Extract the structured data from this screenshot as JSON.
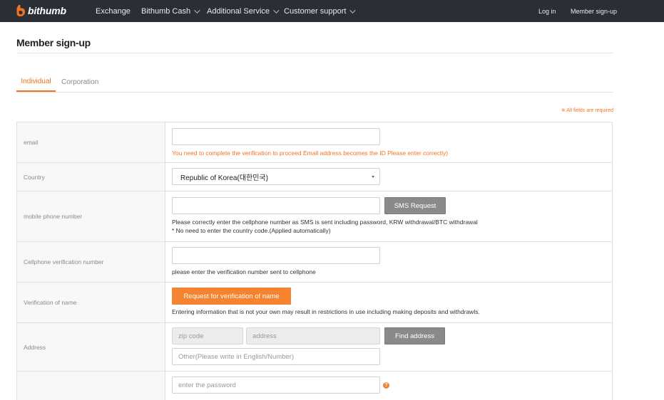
{
  "nav": {
    "logo": "bithumb",
    "items": [
      "Exchange",
      "Bithumb Cash",
      "Additional Service",
      "Customer support"
    ],
    "login": "Log in",
    "signup": "Member sign-up"
  },
  "page": {
    "title": "Member sign-up",
    "tabs": [
      "Individual",
      "Corporation"
    ],
    "required_note": "※ All fields are required"
  },
  "form": {
    "email": {
      "label": "email",
      "value": "",
      "help": "You need to complete the verification to proceed Email address becomes the ID Please enter correctly)"
    },
    "country": {
      "label": "Country",
      "selected": "Republic of Korea(대한민국)"
    },
    "phone": {
      "label": "mobile phone number",
      "value": "",
      "button": "SMS Request",
      "help1": "Please correctly enter the cellphone number as SMS is sent including password, KRW withdrawal/BTC withdrawal",
      "help2": "* No need to enter the country code.(Applied automatically)"
    },
    "verify_code": {
      "label": "Cellphone verification number",
      "value": "",
      "help": "please enter the verification number sent to cellphone"
    },
    "name_verify": {
      "label": "Verification of name",
      "button": "Request for verification of name",
      "help": "Entering information that is not your own may result in restrictions in use including making deposits and withdrawls."
    },
    "address": {
      "label": "Address",
      "zip_placeholder": "zip code",
      "address_placeholder": "address",
      "button": "Find address",
      "other_placeholder": "Other(Please write in English/Number)"
    },
    "password": {
      "placeholder": "enter the password",
      "help_icon": "question-icon"
    }
  },
  "colors": {
    "accent": "#f37321",
    "nav_bg": "#2b2e34"
  }
}
